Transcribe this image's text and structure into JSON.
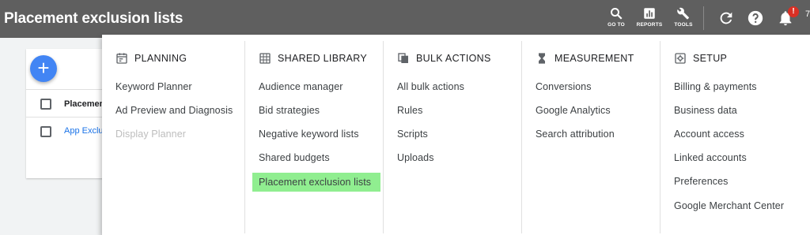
{
  "header": {
    "title": "Placement exclusion lists",
    "actions": [
      {
        "label": "GO TO",
        "icon": "search-icon"
      },
      {
        "label": "REPORTS",
        "icon": "reports-icon"
      },
      {
        "label": "TOOLS",
        "icon": "wrench-icon"
      }
    ],
    "refresh_icon": "refresh-icon",
    "help_icon": "help-icon",
    "notifications_icon": "bell-icon",
    "notification_badge": "!",
    "overflow_text": "7"
  },
  "background": {
    "add_button": "+",
    "table_header": "Placemen",
    "row_link": "App Exclus"
  },
  "menu": {
    "columns": [
      {
        "heading": "PLANNING",
        "icon": "calendar-icon",
        "items": [
          {
            "label": "Keyword Planner",
            "disabled": false
          },
          {
            "label": "Ad Preview and Diagnosis",
            "disabled": false
          },
          {
            "label": "Display Planner",
            "disabled": true
          }
        ]
      },
      {
        "heading": "SHARED LIBRARY",
        "icon": "grid-icon",
        "items": [
          {
            "label": "Audience manager"
          },
          {
            "label": "Bid strategies"
          },
          {
            "label": "Negative keyword lists"
          },
          {
            "label": "Shared budgets"
          },
          {
            "label": "Placement exclusion lists",
            "highlighted": true
          }
        ]
      },
      {
        "heading": "BULK ACTIONS",
        "icon": "copy-icon",
        "items": [
          {
            "label": "All bulk actions"
          },
          {
            "label": "Rules"
          },
          {
            "label": "Scripts"
          },
          {
            "label": "Uploads"
          }
        ]
      },
      {
        "heading": "MEASUREMENT",
        "icon": "hourglass-icon",
        "items": [
          {
            "label": "Conversions"
          },
          {
            "label": "Google Analytics"
          },
          {
            "label": "Search attribution"
          }
        ]
      },
      {
        "heading": "SETUP",
        "icon": "settings-icon",
        "items": [
          {
            "label": "Billing & payments"
          },
          {
            "label": "Business data"
          },
          {
            "label": "Account access"
          },
          {
            "label": "Linked accounts"
          },
          {
            "label": "Preferences"
          },
          {
            "label": "Google Merchant Center"
          }
        ]
      }
    ]
  },
  "colors": {
    "topbar": "#5f5f5f",
    "highlight": "#90ee90",
    "fab": "#4285f4",
    "link": "#1a73e8",
    "badge": "#d93025"
  }
}
